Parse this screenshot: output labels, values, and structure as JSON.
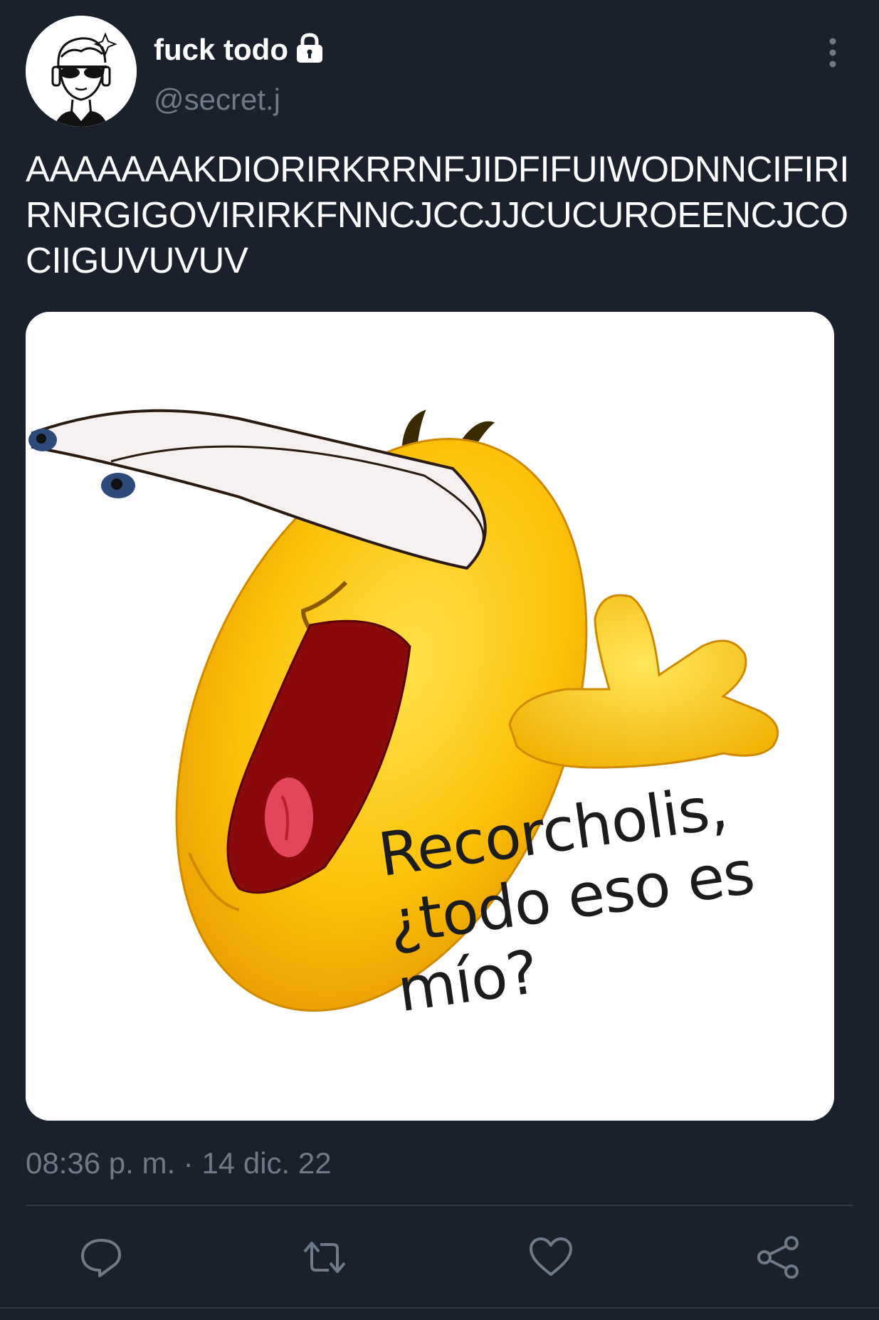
{
  "tweet": {
    "display_name": "fuck todo",
    "handle": "@secret.j",
    "text": "AAAAAAAKDIORIRKRRNFJIDFIFUIWODNNCIFIRIRNRGIGOVIRIRKFNNCJCCJJCUCUROEENCJCOCIIGUVUVUV",
    "timestamp": "08:36 p. m. · 14 dic. 22",
    "account_locked_icon": "lock-icon",
    "menu_icon": "more-vertical-icon"
  },
  "media": {
    "caption_lines": [
      "Recorcholis,",
      "¿todo eso es",
      "mío?"
    ],
    "subject": "emoji-meme-image"
  },
  "actions": [
    {
      "name": "reply",
      "icon": "reply-icon"
    },
    {
      "name": "retweet",
      "icon": "retweet-icon"
    },
    {
      "name": "like",
      "icon": "heart-icon"
    },
    {
      "name": "share",
      "icon": "share-icon"
    }
  ],
  "colors": {
    "background": "#1a212c",
    "text_primary": "#ffffff",
    "text_secondary": "#6e7a88",
    "divider": "#2f3742"
  }
}
